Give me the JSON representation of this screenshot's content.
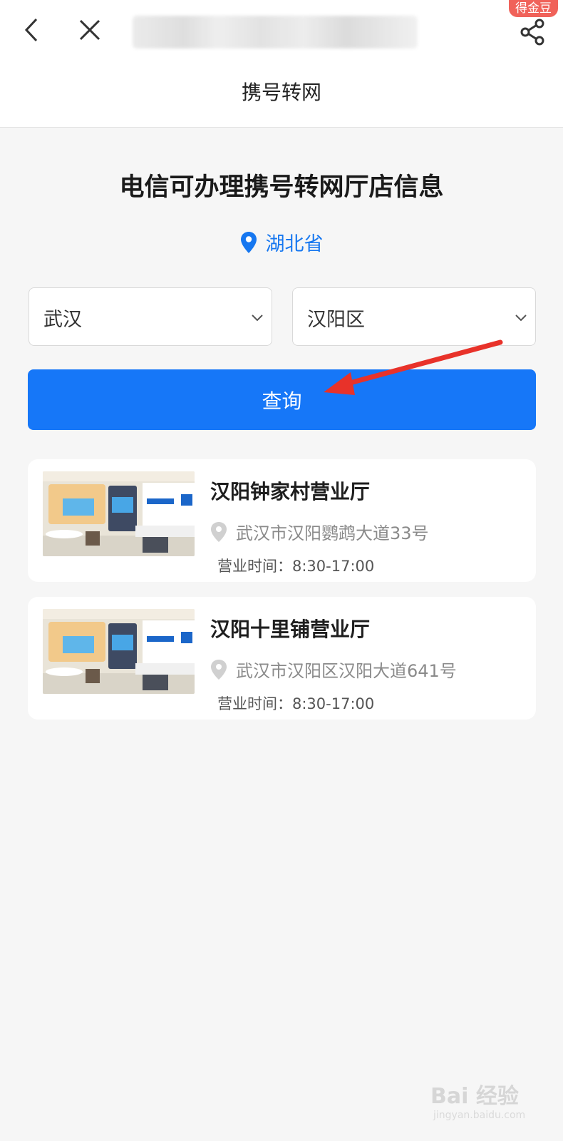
{
  "topbar": {
    "badge": "得金豆",
    "page_title": "携号转网"
  },
  "main": {
    "heading": "电信可办理携号转网厅店信息",
    "province": "湖北省",
    "city_select": {
      "value": "武汉"
    },
    "district_select": {
      "value": "汉阳区"
    },
    "query_button": "查询"
  },
  "stores": [
    {
      "name": "汉阳钟家村营业厅",
      "address": "武汉市汉阳鹦鹉大道33号",
      "hours": "营业时间：8:30-17:00"
    },
    {
      "name": "汉阳十里铺营业厅",
      "address": "武汉市汉阳区汉阳大道641号",
      "hours": "营业时间：8:30-17:00"
    }
  ],
  "colors": {
    "accent": "#1677f8",
    "badge": "#f0625a",
    "annotation_arrow": "#e8322a"
  },
  "watermark": {
    "main": "Bai 经验",
    "sub": "jingyan.baidu.com"
  }
}
